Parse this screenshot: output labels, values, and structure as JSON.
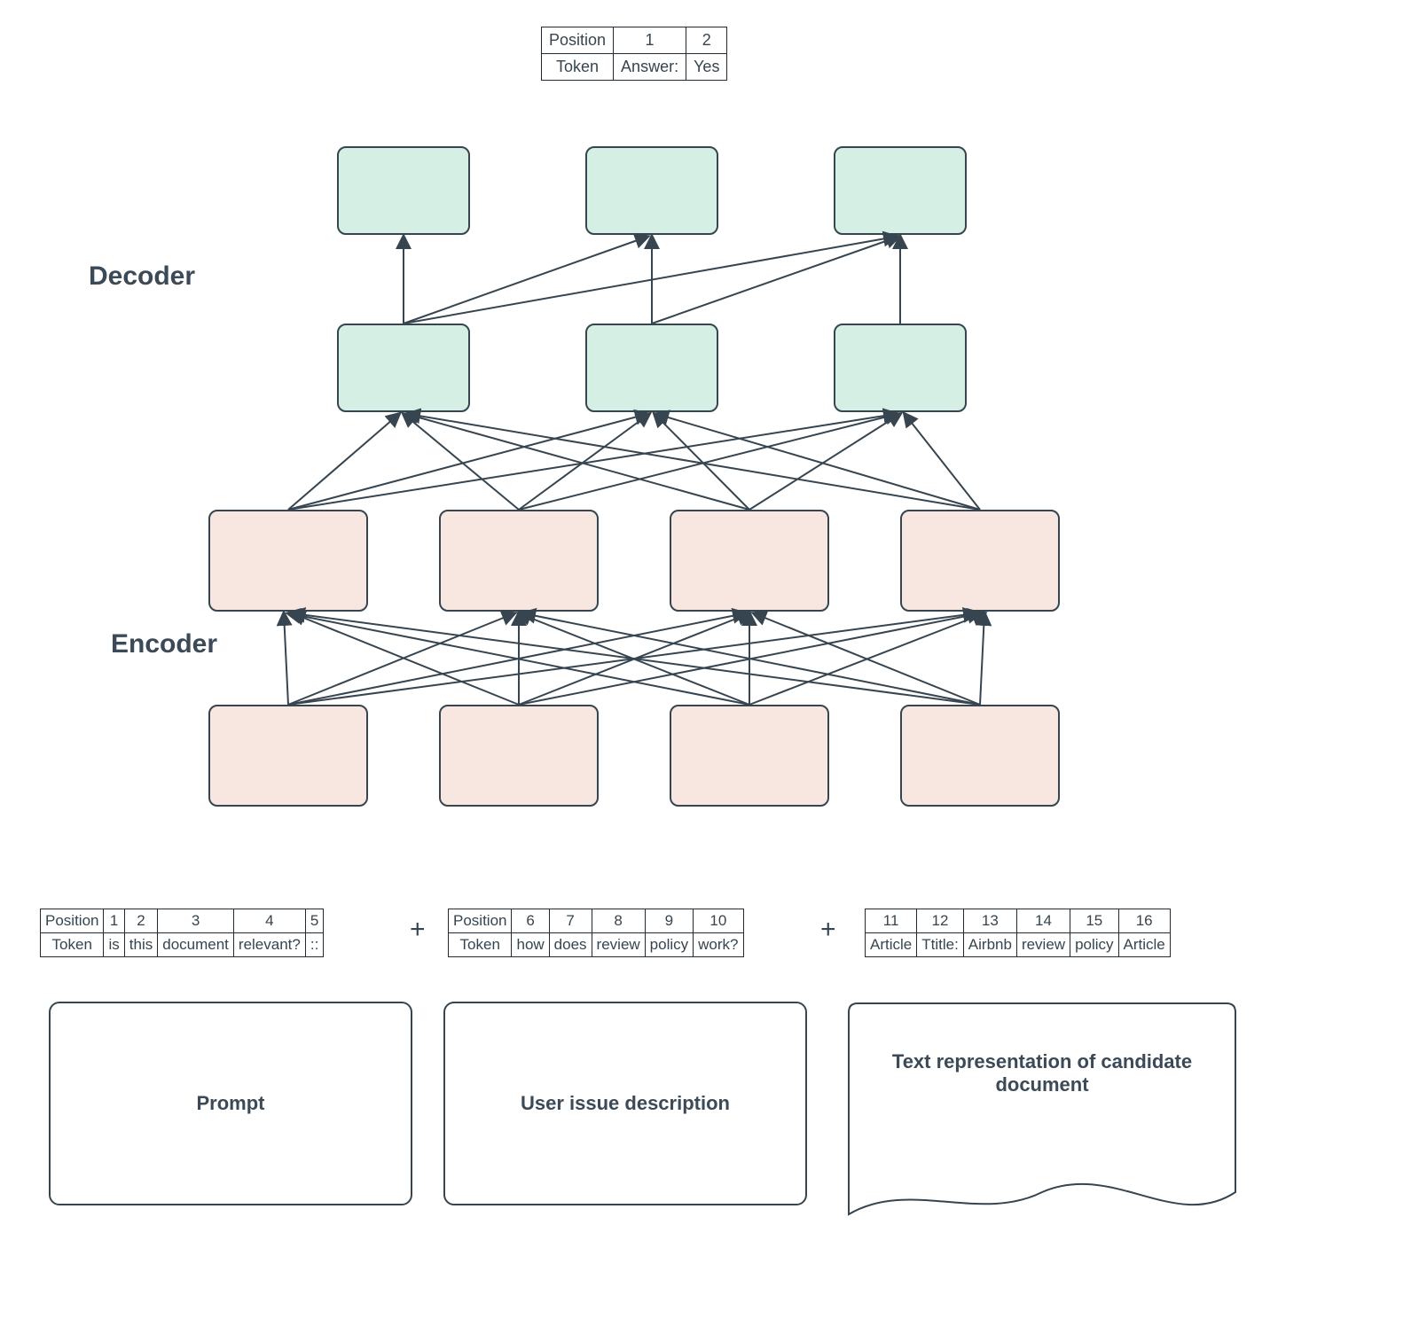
{
  "output_table": {
    "rows": [
      [
        "Position",
        "1",
        "2"
      ],
      [
        "Token",
        "Answer:",
        "Yes"
      ]
    ]
  },
  "labels": {
    "decoder": "Decoder",
    "encoder": "Encoder"
  },
  "input_tables": {
    "prompt": {
      "rows": [
        [
          "Position",
          "1",
          "2",
          "3",
          "4",
          "5"
        ],
        [
          "Token",
          "is",
          "this",
          "document",
          "relevant?",
          "::"
        ]
      ]
    },
    "user_issue": {
      "rows": [
        [
          "Position",
          "6",
          "7",
          "8",
          "9",
          "10"
        ],
        [
          "Token",
          "how",
          "does",
          "review",
          "policy",
          "work?"
        ]
      ]
    },
    "document": {
      "rows": [
        [
          "11",
          "12",
          "13",
          "14",
          "15",
          "16"
        ],
        [
          "Article",
          "Ttitle:",
          "Airbnb",
          "review",
          "policy",
          "Article"
        ]
      ]
    }
  },
  "plus_symbol": "+",
  "bottom_boxes": {
    "prompt": "Prompt",
    "user_issue": "User issue description",
    "document": "Text representation of candidate document"
  },
  "chart_data": {
    "type": "diagram",
    "description": "Encoder-decoder transformer architecture. Input is concatenation of Prompt tokens (positions 1-5), User issue description tokens (positions 6-10), and candidate document text (positions 11-16). The encoder has 2 layers of 4 blocks with full bipartite connections between layers. The decoder has 2 layers of 3 blocks with full cross-attention from top encoder layer to bottom decoder layer, and causal (left-to-right) self-attention between decoder layers. Output tokens at positions 1-2 are 'Answer:' and 'Yes'.",
    "encoder_layers": 2,
    "encoder_blocks_per_layer": 4,
    "decoder_layers": 2,
    "decoder_blocks_per_layer": 3,
    "encoder_connectivity": "full-bipartite",
    "decoder_self_attention": "causal",
    "cross_attention": "full"
  }
}
